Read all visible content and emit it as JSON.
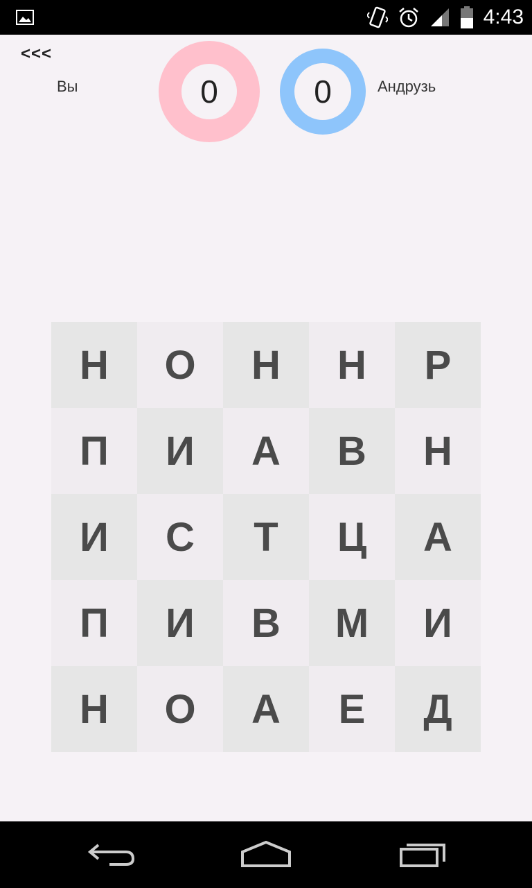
{
  "status_bar": {
    "time": "4:43",
    "icons": [
      "image-icon",
      "vibrate-icon",
      "alarm-icon",
      "signal-icon",
      "battery-icon"
    ]
  },
  "header": {
    "back_label": "<<<",
    "player_you": {
      "name": "Вы",
      "score": "0",
      "ring_color": "#ffc0cc"
    },
    "player_opp": {
      "name": "Андрузь",
      "score": "0",
      "ring_color": "#8ec5fb"
    }
  },
  "board": {
    "rows": [
      [
        "Н",
        "О",
        "Н",
        "Н",
        "Р"
      ],
      [
        "П",
        "И",
        "А",
        "В",
        "Н"
      ],
      [
        "И",
        "С",
        "Т",
        "Ц",
        "А"
      ],
      [
        "П",
        "И",
        "В",
        "М",
        "И"
      ],
      [
        "Н",
        "О",
        "А",
        "Е",
        "Д"
      ]
    ]
  },
  "nav_bar": {
    "icons": [
      "back-icon",
      "home-icon",
      "recent-apps-icon"
    ]
  }
}
